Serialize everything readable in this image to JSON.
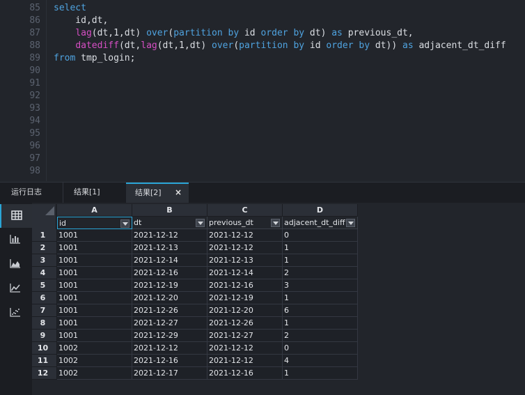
{
  "editor": {
    "line_numbers": [
      "85",
      "86",
      "87",
      "88",
      "89",
      "90",
      "91",
      "92",
      "93",
      "94",
      "95",
      "96",
      "97",
      "98"
    ],
    "lines": [
      [
        {
          "t": "select",
          "c": "kw"
        }
      ],
      [
        {
          "t": "    id,dt,",
          "c": "op"
        }
      ],
      [
        {
          "t": "    ",
          "c": "op"
        },
        {
          "t": "lag",
          "c": "fn"
        },
        {
          "t": "(dt,1,dt) ",
          "c": "op"
        },
        {
          "t": "over",
          "c": "kw"
        },
        {
          "t": "(",
          "c": "op"
        },
        {
          "t": "partition",
          "c": "kw"
        },
        {
          "t": " ",
          "c": "op"
        },
        {
          "t": "by",
          "c": "kw"
        },
        {
          "t": " id ",
          "c": "op"
        },
        {
          "t": "order",
          "c": "kw"
        },
        {
          "t": " ",
          "c": "op"
        },
        {
          "t": "by",
          "c": "kw"
        },
        {
          "t": " dt) ",
          "c": "op"
        },
        {
          "t": "as",
          "c": "kw"
        },
        {
          "t": " previous_dt,",
          "c": "op"
        }
      ],
      [
        {
          "t": "    ",
          "c": "op"
        },
        {
          "t": "datediff",
          "c": "fn"
        },
        {
          "t": "(dt,",
          "c": "op"
        },
        {
          "t": "lag",
          "c": "fn"
        },
        {
          "t": "(dt,1,dt) ",
          "c": "op"
        },
        {
          "t": "over",
          "c": "kw"
        },
        {
          "t": "(",
          "c": "op"
        },
        {
          "t": "partition",
          "c": "kw"
        },
        {
          "t": " ",
          "c": "op"
        },
        {
          "t": "by",
          "c": "kw"
        },
        {
          "t": " id ",
          "c": "op"
        },
        {
          "t": "order",
          "c": "kw"
        },
        {
          "t": " ",
          "c": "op"
        },
        {
          "t": "by",
          "c": "kw"
        },
        {
          "t": " dt)) ",
          "c": "op"
        },
        {
          "t": "as",
          "c": "kw"
        },
        {
          "t": " adjacent_dt_diff",
          "c": "op"
        }
      ],
      [
        {
          "t": "from",
          "c": "kw"
        },
        {
          "t": " tmp_login;",
          "c": "op"
        }
      ]
    ]
  },
  "tabs": {
    "log": "运行日志",
    "result1": "结果[1]",
    "result2": "结果[2]",
    "close": "×"
  },
  "side_icons": [
    "table-icon",
    "bar-chart-icon",
    "area-chart-icon",
    "line-chart-icon",
    "scatter-chart-icon"
  ],
  "grid": {
    "columns": [
      "A",
      "B",
      "C",
      "D"
    ],
    "fields": [
      "id",
      "dt",
      "previous_dt",
      "adjacent_dt_diff"
    ],
    "rows": [
      [
        "1",
        "1001",
        "2021-12-12",
        "2021-12-12",
        "0"
      ],
      [
        "2",
        "1001",
        "2021-12-13",
        "2021-12-12",
        "1"
      ],
      [
        "3",
        "1001",
        "2021-12-14",
        "2021-12-13",
        "1"
      ],
      [
        "4",
        "1001",
        "2021-12-16",
        "2021-12-14",
        "2"
      ],
      [
        "5",
        "1001",
        "2021-12-19",
        "2021-12-16",
        "3"
      ],
      [
        "6",
        "1001",
        "2021-12-20",
        "2021-12-19",
        "1"
      ],
      [
        "7",
        "1001",
        "2021-12-26",
        "2021-12-20",
        "6"
      ],
      [
        "8",
        "1001",
        "2021-12-27",
        "2021-12-26",
        "1"
      ],
      [
        "9",
        "1001",
        "2021-12-29",
        "2021-12-27",
        "2"
      ],
      [
        "10",
        "1002",
        "2021-12-12",
        "2021-12-12",
        "0"
      ],
      [
        "11",
        "1002",
        "2021-12-16",
        "2021-12-12",
        "4"
      ],
      [
        "12",
        "1002",
        "2021-12-17",
        "2021-12-16",
        "1"
      ]
    ]
  },
  "colors": {
    "accent": "#2aa5d6",
    "keyword": "#4fa3e0",
    "function": "#d64fc4"
  }
}
